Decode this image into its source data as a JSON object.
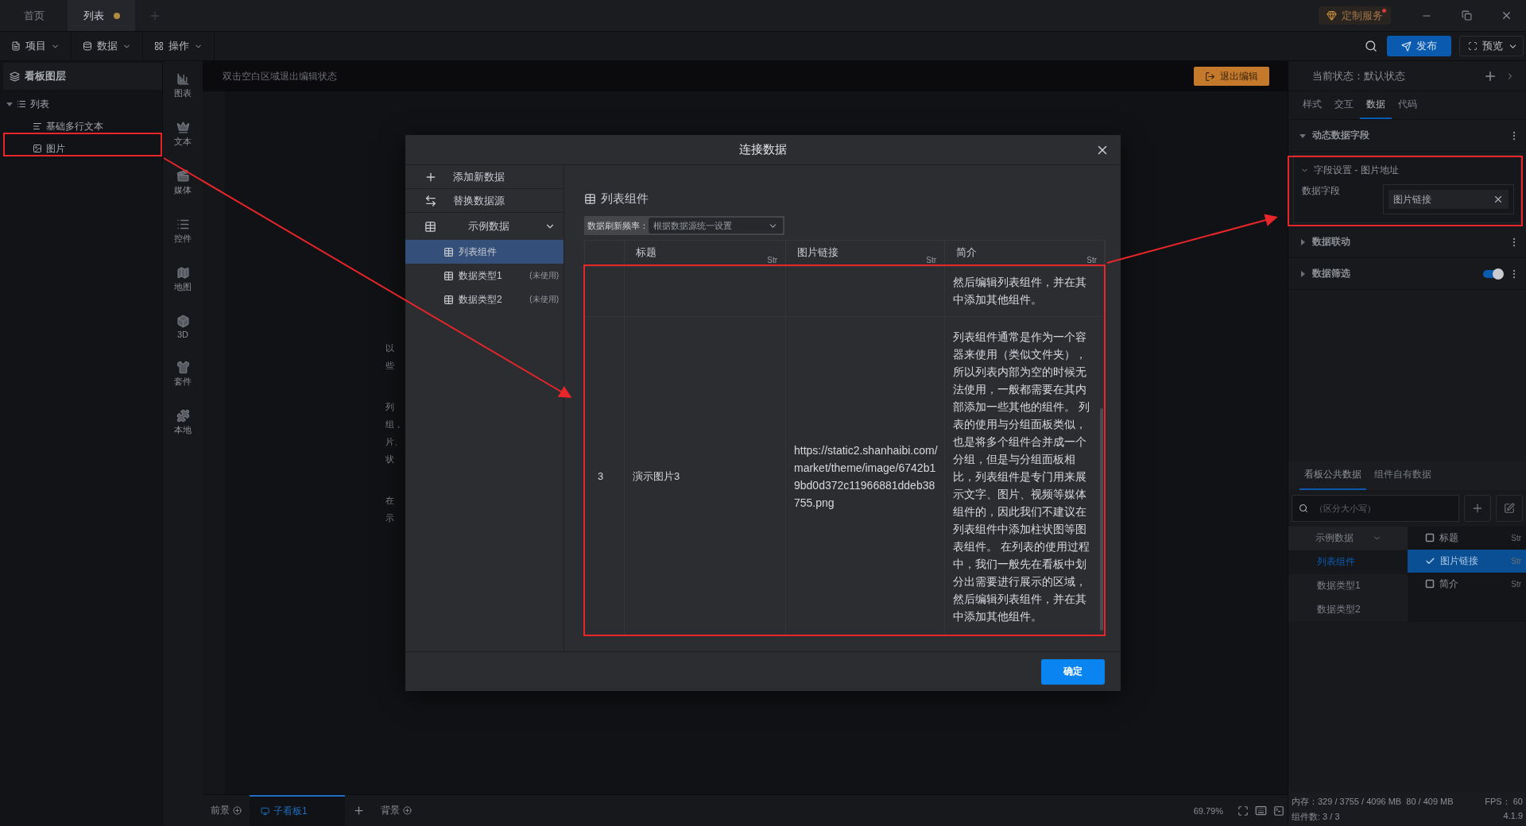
{
  "tabs": [
    {
      "label": "首页",
      "selected": false,
      "unsaved": false
    },
    {
      "label": "列表",
      "selected": true,
      "unsaved": true
    }
  ],
  "custom_service": {
    "label": "定制服务",
    "notification": true
  },
  "toolbar": {
    "menus": [
      {
        "label": "项目",
        "kind": "file"
      },
      {
        "label": "数据",
        "kind": "data"
      },
      {
        "label": "操作",
        "kind": "grid"
      }
    ],
    "publish": "发布",
    "preview": "预览"
  },
  "layers": {
    "title": "看板图层",
    "tree": [
      {
        "label": "列表",
        "kind": "list",
        "expanded": true,
        "children": [
          {
            "label": "基础多行文本",
            "kind": "text"
          },
          {
            "label": "图片",
            "kind": "image"
          }
        ]
      }
    ]
  },
  "component_bar": [
    {
      "label": "图表",
      "kind": "chart"
    },
    {
      "label": "文本",
      "kind": "text"
    },
    {
      "label": "媒体",
      "kind": "media"
    },
    {
      "label": "控件",
      "kind": "control"
    },
    {
      "label": "地图",
      "kind": "map"
    },
    {
      "label": "3D",
      "kind": "cube"
    },
    {
      "label": "套件",
      "kind": "kit"
    },
    {
      "label": "本地",
      "kind": "local"
    }
  ],
  "canvas": {
    "hint": "双击空白区域退出编辑状态",
    "exit_button": "退出编辑",
    "paragraphs": [
      [
        "以",
        "些"
      ],
      [
        "列",
        "组，",
        "片、",
        "状"
      ],
      [
        "在",
        "示"
      ]
    ]
  },
  "dialog": {
    "title": "连接数据",
    "actions": [
      {
        "label": "添加新数据",
        "kind": "add"
      },
      {
        "label": "替换数据源",
        "kind": "swap"
      }
    ],
    "source_group": {
      "label": "示例数据",
      "expanded": true,
      "items": [
        {
          "label": "列表组件",
          "selected": true
        },
        {
          "label": "数据类型1",
          "note": "(未使用)",
          "selected": false
        },
        {
          "label": "数据类型2",
          "note": "(未使用)",
          "selected": false
        }
      ]
    },
    "heading": "列表组件",
    "refresh": {
      "label": "数据刷新频率：",
      "value": "根据数据源统一设置"
    },
    "columns": [
      {
        "label": "标题",
        "type": "Str"
      },
      {
        "label": "图片链接",
        "type": "Str"
      },
      {
        "label": "简介",
        "type": "Str"
      }
    ],
    "rows": [
      {
        "intro": "然后编辑列表组件，并在其中添加其他组件。"
      },
      {
        "index": "3",
        "title": "演示图片3",
        "image_link": "https://static2.shanhaibi.com/market/theme/image/6742b19bd0d372c11966881ddeb38755.png",
        "intro": "列表组件通常是作为一个容器来使用（类似文件夹），所以列表内部为空的时候无法使用，一般都需要在其内部添加一些其他的组件。 列表的使用与分组面板类似，也是将多个组件合并成一个分组，但是与分组面板相比，列表组件是专门用来展示文字、图片、视频等媒体组件的，因此我们不建议在列表组件中添加柱状图等图表组件。 在列表的使用过程中，我们一般先在看板中划分出需要进行展示的区域，然后编辑列表组件，并在其中添加其他组件。"
      }
    ],
    "confirm": "确定"
  },
  "inspector": {
    "state_label": "当前状态：",
    "state_value": "默认状态",
    "tabs": [
      {
        "label": "样式",
        "selected": false
      },
      {
        "label": "交互",
        "selected": false
      },
      {
        "label": "数据",
        "selected": true
      },
      {
        "label": "代码",
        "selected": false
      }
    ],
    "sections": [
      {
        "kind": "header",
        "label": "动态数据字段",
        "expanded": true
      },
      {
        "kind": "field",
        "label": "字段设置 - 图片地址",
        "expanded": true,
        "field_label": "数据字段",
        "value": "图片链接"
      },
      {
        "kind": "header",
        "label": "数据联动",
        "expanded": false
      },
      {
        "kind": "toggle",
        "label": "数据筛选",
        "expanded": false,
        "on": true
      }
    ],
    "data_tabs": [
      {
        "label": "看板公共数据",
        "selected": true
      },
      {
        "label": "组件自有数据",
        "selected": false
      }
    ],
    "search_placeholder": "（区分大小写）",
    "sources": {
      "group": "示例数据",
      "expanded": true,
      "items": [
        {
          "label": "列表组件",
          "selected": true
        },
        {
          "label": "数据类型1",
          "selected": false
        },
        {
          "label": "数据类型2",
          "selected": false
        }
      ]
    },
    "fields": [
      {
        "label": "标题",
        "type": "Str",
        "checked": false
      },
      {
        "label": "图片链接",
        "type": "Str",
        "checked": true
      },
      {
        "label": "简介",
        "type": "Str",
        "checked": false
      }
    ]
  },
  "boards": {
    "foreground": "前景",
    "tabs": [
      {
        "label": "子看板1",
        "selected": true
      }
    ],
    "background": "背景",
    "zoom": "69.79%"
  },
  "status": {
    "memory": "内存：329 / 3755 / 4096 MB  80 / 409 MB",
    "fps_label": "FPS：",
    "fps": "60",
    "components": "组件数: 3 / 3",
    "version": "4.1.9"
  }
}
